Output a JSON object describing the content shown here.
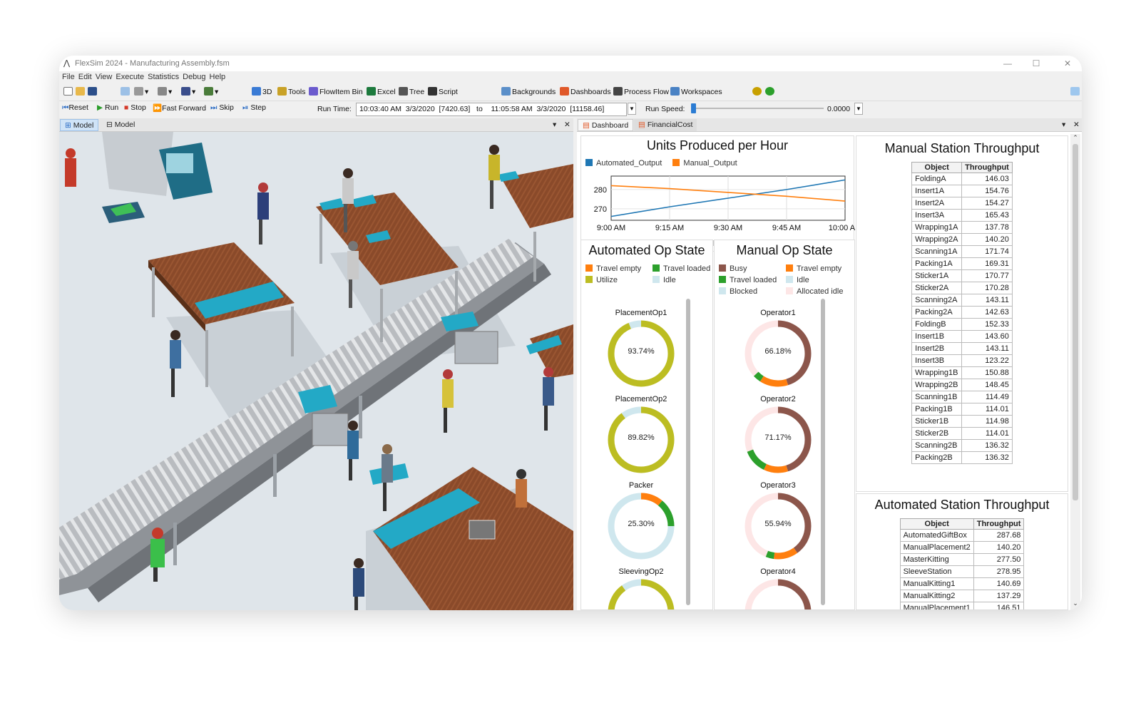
{
  "window": {
    "title": "FlexSim 2024 - Manufacturing Assembly.fsm"
  },
  "menu": [
    "File",
    "Edit",
    "View",
    "Execute",
    "Statistics",
    "Debug",
    "Help"
  ],
  "toolbar": {
    "threed": "3D",
    "tools": "Tools",
    "flowitem_bin": "FlowItem Bin",
    "excel": "Excel",
    "tree": "Tree",
    "script": "Script",
    "backgrounds": "Backgrounds",
    "dashboards": "Dashboards",
    "process_flow": "Process Flow",
    "workspaces": "Workspaces"
  },
  "runbar": {
    "reset": "Reset",
    "run": "Run",
    "stop": "Stop",
    "fast_forward": "Fast Forward",
    "skip": "Skip",
    "step": "Step",
    "run_time_label": "Run Time:",
    "run_time_value": "10:03:40 AM  3/3/2020  [7420.63]   to    11:05:58 AM  3/3/2020  [11158.46]",
    "run_speed_label": "Run Speed:",
    "run_speed_value": "0.0000",
    "run_speed_fraction": 0.0
  },
  "left_pane": {
    "tabs": [
      "Model",
      "Model"
    ]
  },
  "right_pane": {
    "tabs": [
      "Dashboard",
      "FinancialCost"
    ]
  },
  "colors": {
    "blue": "#1f77b4",
    "orange": "#ff7f0e",
    "olive": "#bcbd22",
    "green": "#2ca02c",
    "lightblue": "#cfe7ee",
    "brown": "#8c564b",
    "pink": "#fde6e6"
  },
  "chart_data": {
    "type": "line",
    "title": "Units Produced per Hour",
    "x": [
      "9:00 AM",
      "9:15 AM",
      "9:30 AM",
      "9:45 AM",
      "10:00 AM"
    ],
    "series": [
      {
        "name": "Automated_Output",
        "values": [
          266,
          271,
          275.5,
          280,
          285
        ],
        "color": "#1f77b4"
      },
      {
        "name": "Manual_Output",
        "values": [
          282,
          280.5,
          278.5,
          276.5,
          274
        ],
        "color": "#ff7f0e"
      }
    ],
    "yticks": [
      270,
      280
    ],
    "ylim": [
      264,
      287
    ]
  },
  "automated_state": {
    "title": "Automated Op State",
    "legend": [
      {
        "label": "Travel empty",
        "color": "#ff7f0e"
      },
      {
        "label": "Travel loaded",
        "color": "#2ca02c"
      },
      {
        "label": "Utilize",
        "color": "#bcbd22"
      },
      {
        "label": "Idle",
        "color": "#cfe7ee"
      }
    ],
    "donuts": [
      {
        "name": "PlacementOp1",
        "label": "93.74%",
        "segments": [
          {
            "v": 0.9374,
            "c": "#bcbd22"
          },
          {
            "v": 0.0626,
            "c": "#cfe7ee"
          }
        ]
      },
      {
        "name": "PlacementOp2",
        "label": "89.82%",
        "segments": [
          {
            "v": 0.8982,
            "c": "#bcbd22"
          },
          {
            "v": 0.1018,
            "c": "#cfe7ee"
          }
        ]
      },
      {
        "name": "Packer",
        "label": "25.30%",
        "segments": [
          {
            "v": 0.11,
            "c": "#ff7f0e"
          },
          {
            "v": 0.14,
            "c": "#2ca02c"
          },
          {
            "v": 0.75,
            "c": "#cfe7ee"
          }
        ]
      },
      {
        "name": "SleevingOp2",
        "label": "",
        "segments": [
          {
            "v": 0.9,
            "c": "#bcbd22"
          },
          {
            "v": 0.1,
            "c": "#cfe7ee"
          }
        ]
      }
    ]
  },
  "manual_state": {
    "title": "Manual Op State",
    "legend": [
      {
        "label": "Busy",
        "color": "#8c564b"
      },
      {
        "label": "Travel empty",
        "color": "#ff7f0e"
      },
      {
        "label": "Travel loaded",
        "color": "#2ca02c"
      },
      {
        "label": "Idle",
        "color": "#cfe7ee"
      },
      {
        "label": "Blocked",
        "color": "#cfe7ee"
      },
      {
        "label": "Allocated idle",
        "color": "#fde6e6"
      }
    ],
    "donuts": [
      {
        "name": "Operator1",
        "label": "66.18%",
        "segments": [
          {
            "v": 0.45,
            "c": "#8c564b"
          },
          {
            "v": 0.14,
            "c": "#ff7f0e"
          },
          {
            "v": 0.04,
            "c": "#2ca02c"
          },
          {
            "v": 0.37,
            "c": "#fde6e6"
          }
        ]
      },
      {
        "name": "Operator2",
        "label": "71.17%",
        "segments": [
          {
            "v": 0.45,
            "c": "#8c564b"
          },
          {
            "v": 0.12,
            "c": "#ff7f0e"
          },
          {
            "v": 0.12,
            "c": "#2ca02c"
          },
          {
            "v": 0.31,
            "c": "#fde6e6"
          }
        ]
      },
      {
        "name": "Operator3",
        "label": "55.94%",
        "segments": [
          {
            "v": 0.4,
            "c": "#8c564b"
          },
          {
            "v": 0.12,
            "c": "#ff7f0e"
          },
          {
            "v": 0.04,
            "c": "#2ca02c"
          },
          {
            "v": 0.44,
            "c": "#fde6e6"
          }
        ]
      },
      {
        "name": "Operator4",
        "label": "",
        "segments": [
          {
            "v": 0.45,
            "c": "#8c564b"
          },
          {
            "v": 0.55,
            "c": "#fde6e6"
          }
        ]
      }
    ]
  },
  "manual_table": {
    "title": "Manual Station Throughput",
    "headers": [
      "Object",
      "Throughput"
    ],
    "rows": [
      [
        "FoldingA",
        "146.03"
      ],
      [
        "Insert1A",
        "154.76"
      ],
      [
        "Insert2A",
        "154.27"
      ],
      [
        "Insert3A",
        "165.43"
      ],
      [
        "Wrapping1A",
        "137.78"
      ],
      [
        "Wrapping2A",
        "140.20"
      ],
      [
        "Scanning1A",
        "171.74"
      ],
      [
        "Packing1A",
        "169.31"
      ],
      [
        "Sticker1A",
        "170.77"
      ],
      [
        "Sticker2A",
        "170.28"
      ],
      [
        "Scanning2A",
        "143.11"
      ],
      [
        "Packing2A",
        "142.63"
      ],
      [
        "FoldingB",
        "152.33"
      ],
      [
        "Insert1B",
        "143.60"
      ],
      [
        "Insert2B",
        "143.11"
      ],
      [
        "Insert3B",
        "123.22"
      ],
      [
        "Wrapping1B",
        "150.88"
      ],
      [
        "Wrapping2B",
        "148.45"
      ],
      [
        "Scanning1B",
        "114.49"
      ],
      [
        "Packing1B",
        "114.01"
      ],
      [
        "Sticker1B",
        "114.98"
      ],
      [
        "Sticker2B",
        "114.01"
      ],
      [
        "Scanning2B",
        "136.32"
      ],
      [
        "Packing2B",
        "136.32"
      ]
    ]
  },
  "auto_table": {
    "title": "Automated Station Throughput",
    "headers": [
      "Object",
      "Throughput"
    ],
    "rows": [
      [
        "AutomatedGiftBox",
        "287.68"
      ],
      [
        "ManualPlacement2",
        "140.20"
      ],
      [
        "MasterKitting",
        "277.50"
      ],
      [
        "SleeveStation",
        "278.95"
      ],
      [
        "ManualKitting1",
        "140.69"
      ],
      [
        "ManualKitting2",
        "137.29"
      ],
      [
        "ManualPlacement1",
        "146.51"
      ]
    ]
  }
}
